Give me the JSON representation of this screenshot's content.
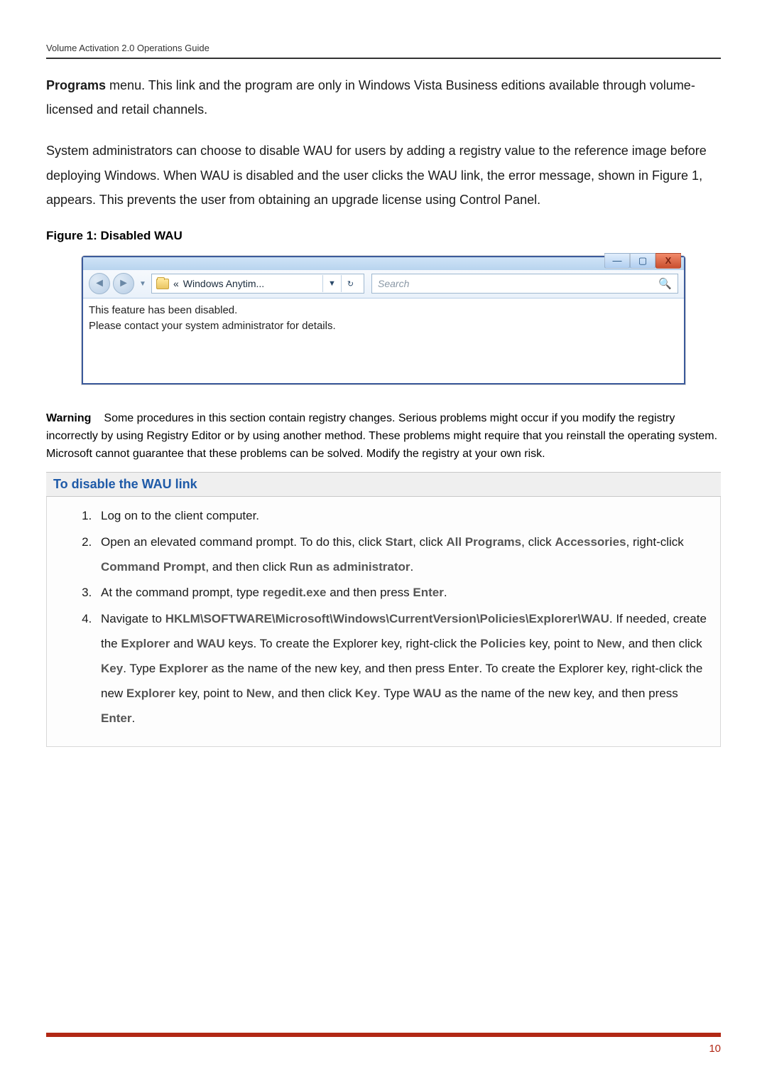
{
  "header": {
    "title": "Volume Activation 2.0 Operations Guide"
  },
  "intro": {
    "programs_bold": "Programs",
    "line1_rest": " menu. This link and the program are only in Windows Vista Business editions available through volume-licensed and retail channels.",
    "line2": "System administrators can choose to disable WAU for users by adding a registry value to the reference image before deploying Windows. When WAU is disabled and the user clicks the WAU link, the error message, shown in Figure 1, appears. This prevents the user from obtaining an upgrade license using Control Panel."
  },
  "figure": {
    "caption": "Figure 1: Disabled WAU",
    "breadcrumb_prefix": "«  ",
    "breadcrumb_text": "Windows Anytim...",
    "search_placeholder": "Search",
    "content_line1": "This feature has been disabled.",
    "content_line2": "Please contact your system administrator for details."
  },
  "warning": {
    "label": "Warning",
    "text": "Some procedures in this section contain registry changes. Serious problems might occur if you modify the registry incorrectly by using Registry Editor or by using another method. These problems might require that you reinstall the operating system. Microsoft cannot guarantee that these problems can be solved. Modify the registry at your own risk."
  },
  "procedure": {
    "title": "To disable the WAU link",
    "step1": "Log on to the client computer.",
    "step2_a": "Open an elevated command prompt. To do this, click ",
    "step2_start": "Start",
    "step2_b": ", click ",
    "step2_allprograms": "All Programs",
    "step2_c": ", click ",
    "step2_accessories": "Accessories",
    "step2_d": ", right-click ",
    "step2_cmdprompt": "Command Prompt",
    "step2_e": ", and then click ",
    "step2_runas": "Run as administrator",
    "step2_f": ".",
    "step3_a": "At the command prompt, type ",
    "step3_regedit": "regedit.exe",
    "step3_b": " and then press ",
    "step3_enter": "Enter",
    "step3_c": ".",
    "step4_a": "Navigate to ",
    "step4_path": "HKLM\\SOFTWARE\\Microsoft\\Windows\\CurrentVersion\\Policies\\Explorer\\WAU",
    "step4_b": ". If needed, create the ",
    "step4_explorer1": "Explorer",
    "step4_c": " and ",
    "step4_wau1": "WAU",
    "step4_d": " keys. To create the Explorer key, right-click the ",
    "step4_policies": "Policies",
    "step4_e": " key, point to ",
    "step4_new1": "New",
    "step4_f": ", and then click ",
    "step4_key1": "Key",
    "step4_g": ". Type ",
    "step4_explorer2": "Explorer",
    "step4_h": " as the name of the new key, and then press ",
    "step4_enter1": "Enter",
    "step4_i": ". To create the Explorer key, right-click the new ",
    "step4_explorer3": "Explorer",
    "step4_j": " key, point to ",
    "step4_new2": "New",
    "step4_k": ", and then click ",
    "step4_key2": "Key",
    "step4_l": ". Type ",
    "step4_wau2": "WAU",
    "step4_m": " as the name of the new key, and then press ",
    "step4_enter2": "Enter",
    "step4_n": "."
  },
  "footer": {
    "page_number": "10"
  }
}
